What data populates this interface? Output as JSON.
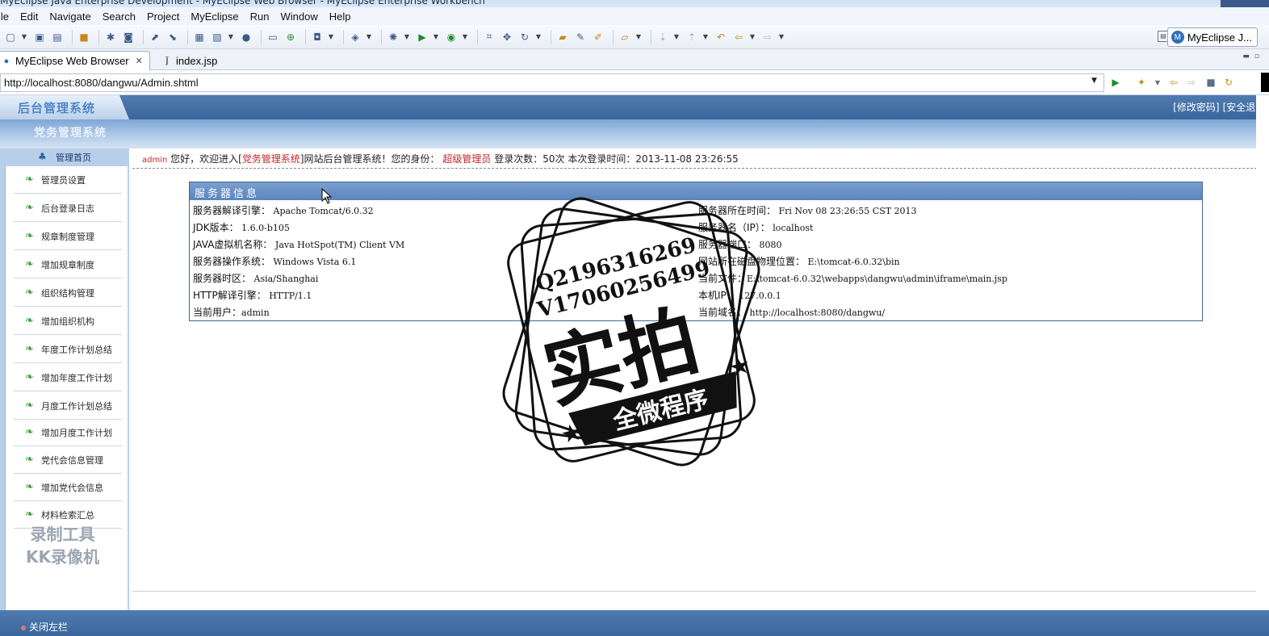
{
  "window": {
    "title": "MyEclipse Java Enterprise Development - MyEclipse Web Browser - MyEclipse Enterprise Workbench"
  },
  "menubar": {
    "items": [
      "ile",
      "Edit",
      "Navigate",
      "Search",
      "Project",
      "MyEclipse",
      "Run",
      "Window",
      "Help"
    ]
  },
  "toolbar": {
    "perspective_label": "MyEclipse J..."
  },
  "tabs": [
    {
      "label": "MyEclipse Web Browser",
      "close": "✕"
    },
    {
      "label": "index.jsp"
    }
  ],
  "browser": {
    "url": "http://localhost:8080/dangwu/Admin.shtml"
  },
  "admin": {
    "header_title": "后台管理系统",
    "sub_title": "党务管理系统",
    "links": [
      "[修改密码]",
      "[安全退出]"
    ],
    "home_label": "管理首页",
    "nav": [
      "管理员设置",
      "后台登录日志",
      "规章制度管理",
      "增加规章制度",
      "组织结构管理",
      "增加组织机构",
      "年度工作计划总结",
      "增加年度工作计划",
      "月度工作计划总结",
      "增加月度工作计划",
      "党代会信息管理",
      "增加党代会信息",
      "材料检索汇总"
    ],
    "greeting": {
      "user": "admin",
      "text1": "您好，欢迎进入[",
      "site": "党务管理系统",
      "text2": "]网站后台管理系统！您的身份：",
      "role": "超级管理员",
      "text3": "登录次数：50次 本次登录时间：2013-11-08 23:26:55"
    },
    "server": {
      "title": "服务器信息",
      "left": [
        {
          "label": "服务器解译引擎：",
          "value": "Apache Tomcat/6.0.32"
        },
        {
          "label": "JDK版本：",
          "value": "1.6.0-b105"
        },
        {
          "label": "JAVA虚拟机名称：",
          "value": "Java HotSpot(TM) Client VM"
        },
        {
          "label": "服务器操作系统：",
          "value": "Windows Vista 6.1"
        },
        {
          "label": "服务器时区：",
          "value": "Asia/Shanghai"
        },
        {
          "label": "HTTP解译引擎：",
          "value": "HTTP/1.1"
        },
        {
          "label": "当前用户：",
          "value": "admin"
        }
      ],
      "right": [
        {
          "label": "服务器所在时间：",
          "value": "Fri Nov 08 23:26:55 CST 2013"
        },
        {
          "label": "服务器名（IP）：",
          "value": "localhost"
        },
        {
          "label": "服务器端口：",
          "value": "8080"
        },
        {
          "label": "网站所在磁盘物理位置：",
          "value": "E:\\tomcat-6.0.32\\bin"
        },
        {
          "label": "当前文件：",
          "value": "E:\\tomcat-6.0.32\\webapps\\dangwu\\admin\\iframe\\main.jsp"
        },
        {
          "label": "本机IP：",
          "value": "127.0.0.1"
        },
        {
          "label": "当前域名：",
          "value": "http://localhost:8080/dangwu/"
        }
      ]
    },
    "close_left": "关闭左栏"
  },
  "overlays": {
    "stamp_line1": "Q2196316269",
    "stamp_line2": "V17060256499",
    "stamp_big": "实拍",
    "stamp_banner": "全微程序",
    "recorder_line1": "录制工具",
    "recorder_line2": "KK录像机"
  },
  "colors": {
    "header_blue": "#3b669d",
    "nav_bg": "#b8cfe9",
    "accent_red": "#c1272d"
  }
}
